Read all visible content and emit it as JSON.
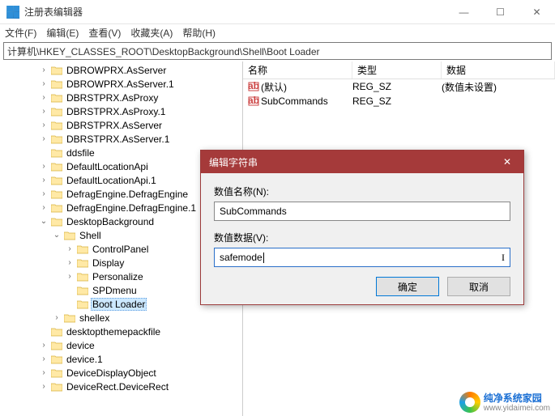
{
  "window": {
    "title": "注册表编辑器",
    "min": "—",
    "max": "☐",
    "close": "✕"
  },
  "menu": [
    "文件(F)",
    "编辑(E)",
    "查看(V)",
    "收藏夹(A)",
    "帮助(H)"
  ],
  "address": "计算机\\HKEY_CLASSES_ROOT\\DesktopBackground\\Shell\\Boot Loader",
  "tree": [
    {
      "d": 3,
      "e": ">",
      "t": "DBROWPRX.AsServer"
    },
    {
      "d": 3,
      "e": ">",
      "t": "DBROWPRX.AsServer.1"
    },
    {
      "d": 3,
      "e": ">",
      "t": "DBRSTPRX.AsProxy"
    },
    {
      "d": 3,
      "e": ">",
      "t": "DBRSTPRX.AsProxy.1"
    },
    {
      "d": 3,
      "e": ">",
      "t": "DBRSTPRX.AsServer"
    },
    {
      "d": 3,
      "e": ">",
      "t": "DBRSTPRX.AsServer.1"
    },
    {
      "d": 3,
      "e": "",
      "t": "ddsfile"
    },
    {
      "d": 3,
      "e": ">",
      "t": "DefaultLocationApi"
    },
    {
      "d": 3,
      "e": ">",
      "t": "DefaultLocationApi.1"
    },
    {
      "d": 3,
      "e": ">",
      "t": "DefragEngine.DefragEngine"
    },
    {
      "d": 3,
      "e": ">",
      "t": "DefragEngine.DefragEngine.1"
    },
    {
      "d": 3,
      "e": "v",
      "t": "DesktopBackground"
    },
    {
      "d": 4,
      "e": "v",
      "t": "Shell"
    },
    {
      "d": 5,
      "e": ">",
      "t": "ControlPanel"
    },
    {
      "d": 5,
      "e": ">",
      "t": "Display"
    },
    {
      "d": 5,
      "e": ">",
      "t": "Personalize"
    },
    {
      "d": 5,
      "e": "",
      "t": "SPDmenu"
    },
    {
      "d": 5,
      "e": "",
      "t": "Boot Loader",
      "sel": true
    },
    {
      "d": 4,
      "e": ">",
      "t": "shellex"
    },
    {
      "d": 3,
      "e": "",
      "t": "desktopthemepackfile"
    },
    {
      "d": 3,
      "e": ">",
      "t": "device"
    },
    {
      "d": 3,
      "e": ">",
      "t": "device.1"
    },
    {
      "d": 3,
      "e": ">",
      "t": "DeviceDisplayObject"
    },
    {
      "d": 3,
      "e": ">",
      "t": "DeviceRect.DeviceRect"
    }
  ],
  "list": {
    "headers": {
      "name": "名称",
      "type": "类型",
      "data": "数据"
    },
    "rows": [
      {
        "icon": "str",
        "name": "(默认)",
        "type": "REG_SZ",
        "data": "(数值未设置)"
      },
      {
        "icon": "str",
        "name": "SubCommands",
        "type": "REG_SZ",
        "data": ""
      }
    ]
  },
  "dialog": {
    "title": "编辑字符串",
    "name_label": "数值名称(N):",
    "name_value": "SubCommands",
    "data_label": "数值数据(V):",
    "data_value": "safemode",
    "ok": "确定",
    "cancel": "取消",
    "close": "✕"
  },
  "watermark": {
    "brand": "纯净系统家园",
    "url": "www.yidaimei.com"
  }
}
